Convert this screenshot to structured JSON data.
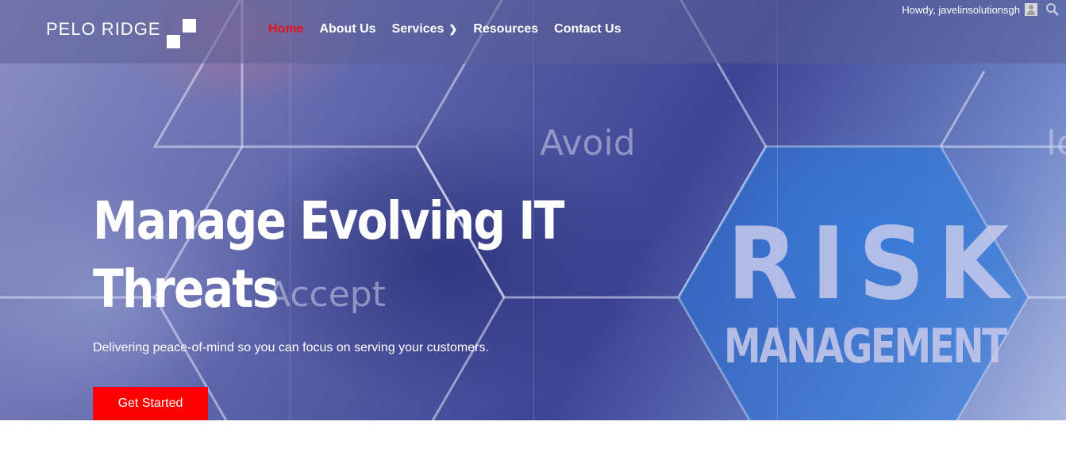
{
  "brand": {
    "name": "PELO RIDGE"
  },
  "nav": {
    "items": [
      {
        "label": "Home",
        "active": true
      },
      {
        "label": "About Us"
      },
      {
        "label": "Services",
        "has_submenu": true
      },
      {
        "label": "Resources"
      },
      {
        "label": "Contact Us"
      }
    ]
  },
  "admin_bar": {
    "greeting": "Howdy, javelinsolutionsgh",
    "icons": [
      "avatar-icon",
      "search-icon"
    ]
  },
  "hero": {
    "headline_line1": "Manage Evolving IT",
    "headline_line2": "Threats",
    "subheading": "Delivering peace-of-mind so you can focus on serving your customers.",
    "cta_label": "Get Started",
    "background_words": {
      "avoid": "Avoid",
      "accept": "Accept",
      "risk": "RISK",
      "management": "MANAGEMENT",
      "edge": "Ic"
    }
  },
  "colors": {
    "accent": "#ff0000",
    "nav_active": "#e8111c",
    "text": "#ffffff"
  }
}
